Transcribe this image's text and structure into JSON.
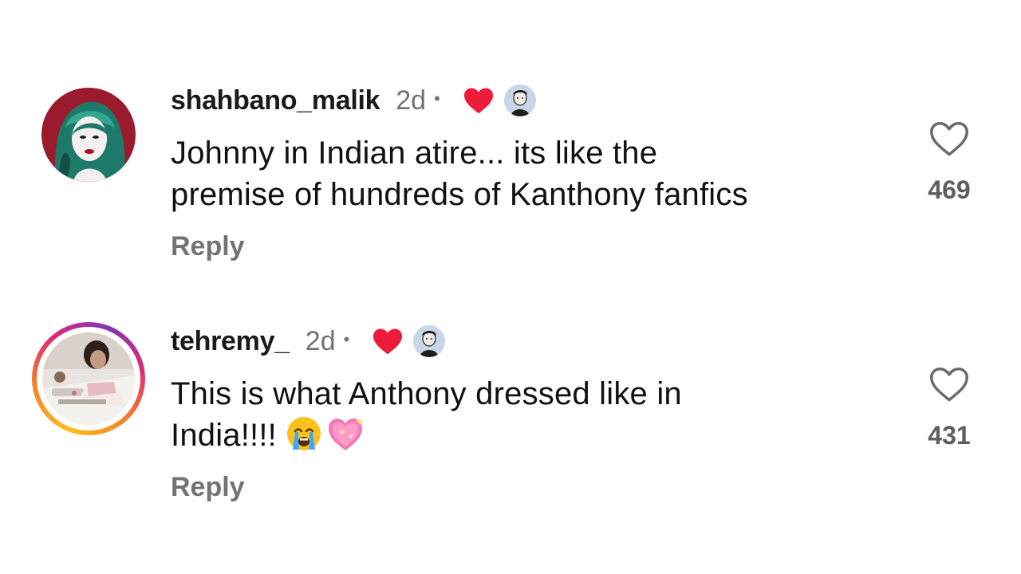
{
  "comments": [
    {
      "username": "shahbano_malik",
      "time": "2d",
      "separator": "•",
      "text_lines": [
        "Johnny in Indian atire... its like the",
        "premise of hundreds of Kanthony fanfics"
      ],
      "reply_label": "Reply",
      "like_count": "469",
      "liked_by_creator": true,
      "has_story_ring": false,
      "icons": [
        "heart-filled-icon",
        "creator-avatar",
        "heart-outline-icon"
      ]
    },
    {
      "username": "tehremy_",
      "time": "2d",
      "separator": "•",
      "text_lines": [
        "This is what Anthony dressed like in",
        "India!!!!"
      ],
      "emojis": [
        "loudly-crying-face-emoji",
        "sparkling-heart-emoji"
      ],
      "reply_label": "Reply",
      "like_count": "431",
      "liked_by_creator": true,
      "has_story_ring": true,
      "icons": [
        "heart-filled-icon",
        "creator-avatar",
        "heart-outline-icon"
      ]
    }
  ],
  "colors": {
    "text": "#111111",
    "muted": "#737373",
    "heart_red": "#ed1c3b",
    "like_count": "#5e5e5e"
  }
}
